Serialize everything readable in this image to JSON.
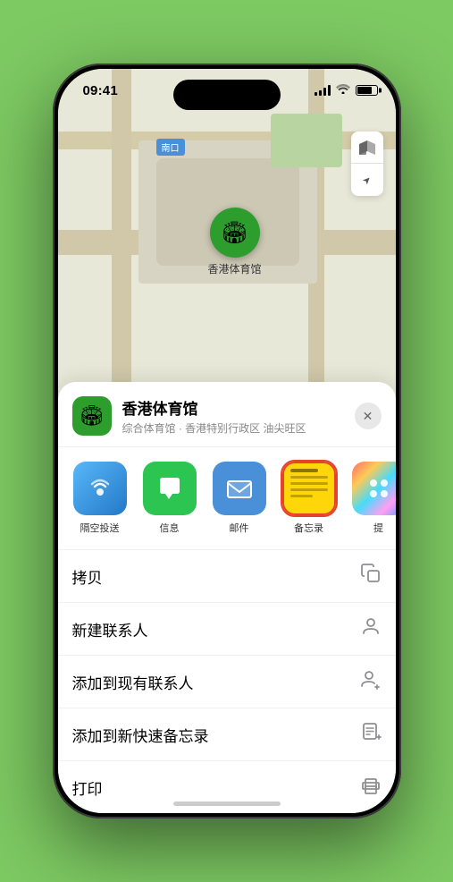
{
  "status_bar": {
    "time": "09:41",
    "navigation_arrow": "▶"
  },
  "map": {
    "south_label": "南口"
  },
  "map_controls": {
    "map_icon": "⊞",
    "location_icon": "⬆"
  },
  "venue": {
    "name": "香港体育馆",
    "subtitle": "综合体育馆 · 香港特别行政区 油尖旺区",
    "emoji": "🏟"
  },
  "share_items": [
    {
      "id": "airdrop",
      "label": "隔空投送",
      "type": "airdrop"
    },
    {
      "id": "messages",
      "label": "信息",
      "type": "messages"
    },
    {
      "id": "mail",
      "label": "邮件",
      "type": "mail"
    },
    {
      "id": "notes",
      "label": "备忘录",
      "type": "notes"
    },
    {
      "id": "more",
      "label": "提",
      "type": "more"
    }
  ],
  "action_rows": [
    {
      "id": "copy",
      "label": "拷贝",
      "icon": "copy"
    },
    {
      "id": "new-contact",
      "label": "新建联系人",
      "icon": "person"
    },
    {
      "id": "add-existing",
      "label": "添加到现有联系人",
      "icon": "person-add"
    },
    {
      "id": "add-notes",
      "label": "添加到新快速备忘录",
      "icon": "notes"
    },
    {
      "id": "print",
      "label": "打印",
      "icon": "print"
    }
  ],
  "close_button": "✕"
}
